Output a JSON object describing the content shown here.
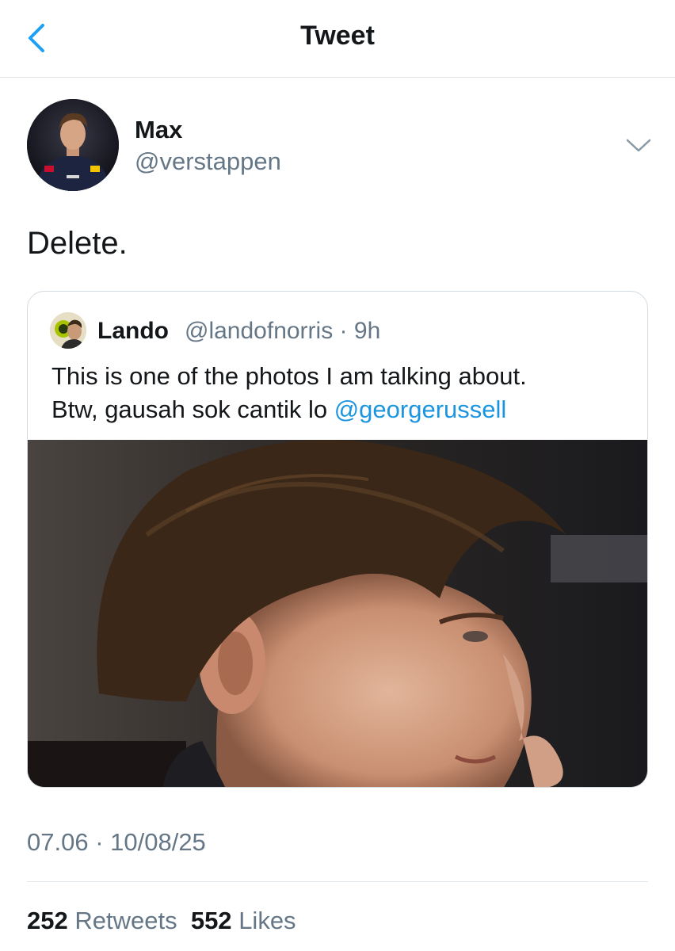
{
  "header": {
    "title": "Tweet"
  },
  "tweet": {
    "author": {
      "name": "Max",
      "handle": "@verstappen"
    },
    "text": "Delete.",
    "quoted": {
      "author": {
        "name": "Lando",
        "handle": "@landofnorris",
        "time": "9h"
      },
      "text_line1": "This is one of the photos I am talking about.",
      "text_line2_prefix": "Btw, gausah sok cantik lo ",
      "mention": "@georgerussell"
    },
    "timestamp": "07.06 · 10/08/25",
    "stats": {
      "retweets_count": "252",
      "retweets_label": "Retweets",
      "likes_count": "552",
      "likes_label": "Likes"
    }
  },
  "colors": {
    "accent": "#1da1f2",
    "link": "#1b95e0",
    "secondary_text": "#657786",
    "border": "#e1e6ea"
  },
  "icons": {
    "back": "chevron-left-icon",
    "more": "chevron-down-icon"
  }
}
